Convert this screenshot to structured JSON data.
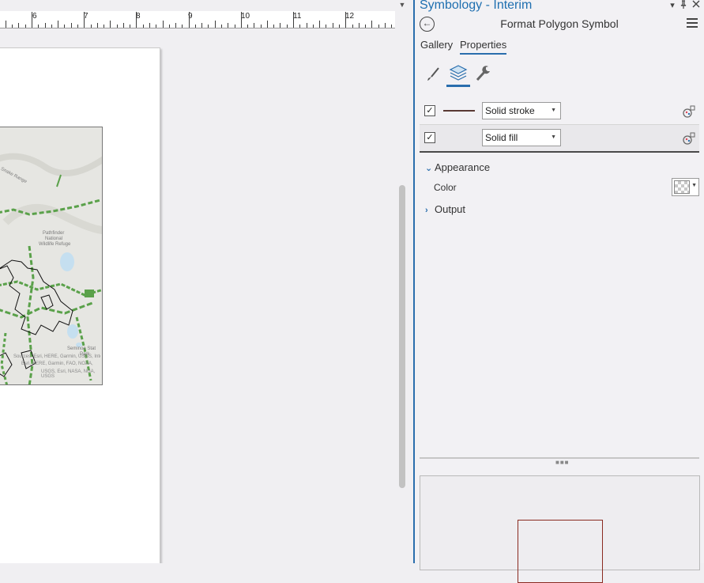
{
  "ruler": {
    "labels": [
      "6",
      "7",
      "8",
      "9",
      "10",
      "11",
      "12"
    ]
  },
  "map": {
    "place_labels": [
      "Snake Range",
      "Pathfinder",
      "National",
      "Wildlife Refuge",
      "Seminoe Stat",
      "Park"
    ],
    "attribution": [
      "Sources: Esri, HERE, Garmin, USGS, Intermap, INCREMENT P, NRCan, Esri Japan, METI, Esri China (Hong Kong), Esri",
      "Esri, HERE, Garmin, FAO, NOAA,",
      "USGS, Esri, NASA, NGA, USGS"
    ]
  },
  "pane": {
    "title": "Symbology - Interim",
    "header_title": "Format Polygon Symbol",
    "tabs": [
      {
        "label": "Gallery",
        "active": false
      },
      {
        "label": "Properties",
        "active": true
      }
    ],
    "tools": [
      "paintbrush-icon",
      "layers-icon",
      "wrench-icon"
    ],
    "layers": [
      {
        "checked": true,
        "type": "Solid stroke",
        "swatch_color": "#5a3a34"
      },
      {
        "checked": true,
        "type": "Solid fill",
        "swatch_color": "transparent"
      }
    ],
    "appearance": {
      "label": "Appearance",
      "expanded": true,
      "color_label": "Color",
      "color_value": "No color"
    },
    "output": {
      "label": "Output",
      "expanded": false
    },
    "preview": {
      "stroke_color": "#8a2a20"
    },
    "accent_color": "#2a6ead"
  }
}
